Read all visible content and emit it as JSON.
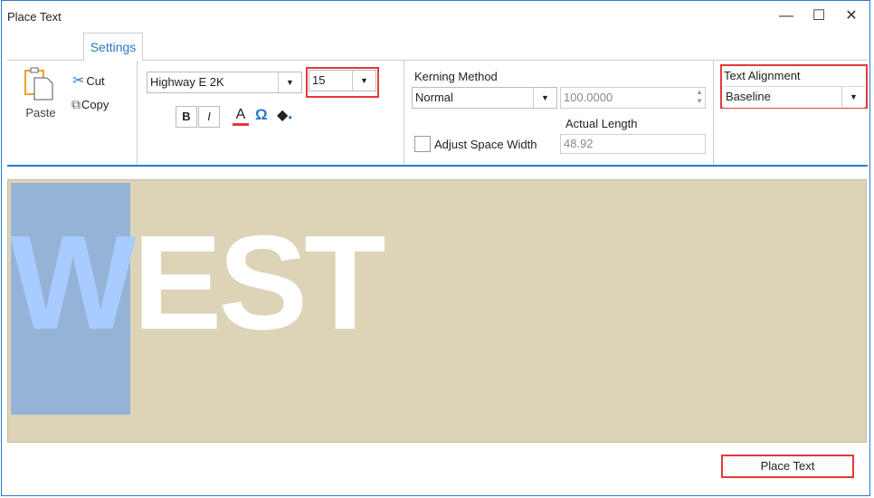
{
  "window": {
    "title": "Place Text",
    "minimize": "—",
    "maximize": "☐",
    "close": "✕"
  },
  "tabs": [
    {
      "label": "Settings"
    }
  ],
  "clipboard": {
    "paste": "Paste",
    "cut": "Cut",
    "copy": "Copy"
  },
  "font": {
    "name": "Highway E 2K",
    "size": "15",
    "bold": "B",
    "italic": "I",
    "color_glyph": "A",
    "symbol_glyph": "Ω"
  },
  "kerning": {
    "label": "Kerning Method",
    "method": "Normal",
    "value": "100.0000",
    "actual_length_label": "Actual Length",
    "actual_length": "48.92",
    "adjust_space_label": "Adjust Space Width",
    "adjust_space_checked": false
  },
  "alignment": {
    "label": "Text Alignment",
    "value": "Baseline"
  },
  "preview": {
    "first_letter": "W",
    "rest": "EST"
  },
  "place_button": "Place Text",
  "colors": {
    "accent": "#2b79c8",
    "canvas": "#ddd4b8",
    "selection": "#95b3d7",
    "highlight": "#e23a3a"
  }
}
